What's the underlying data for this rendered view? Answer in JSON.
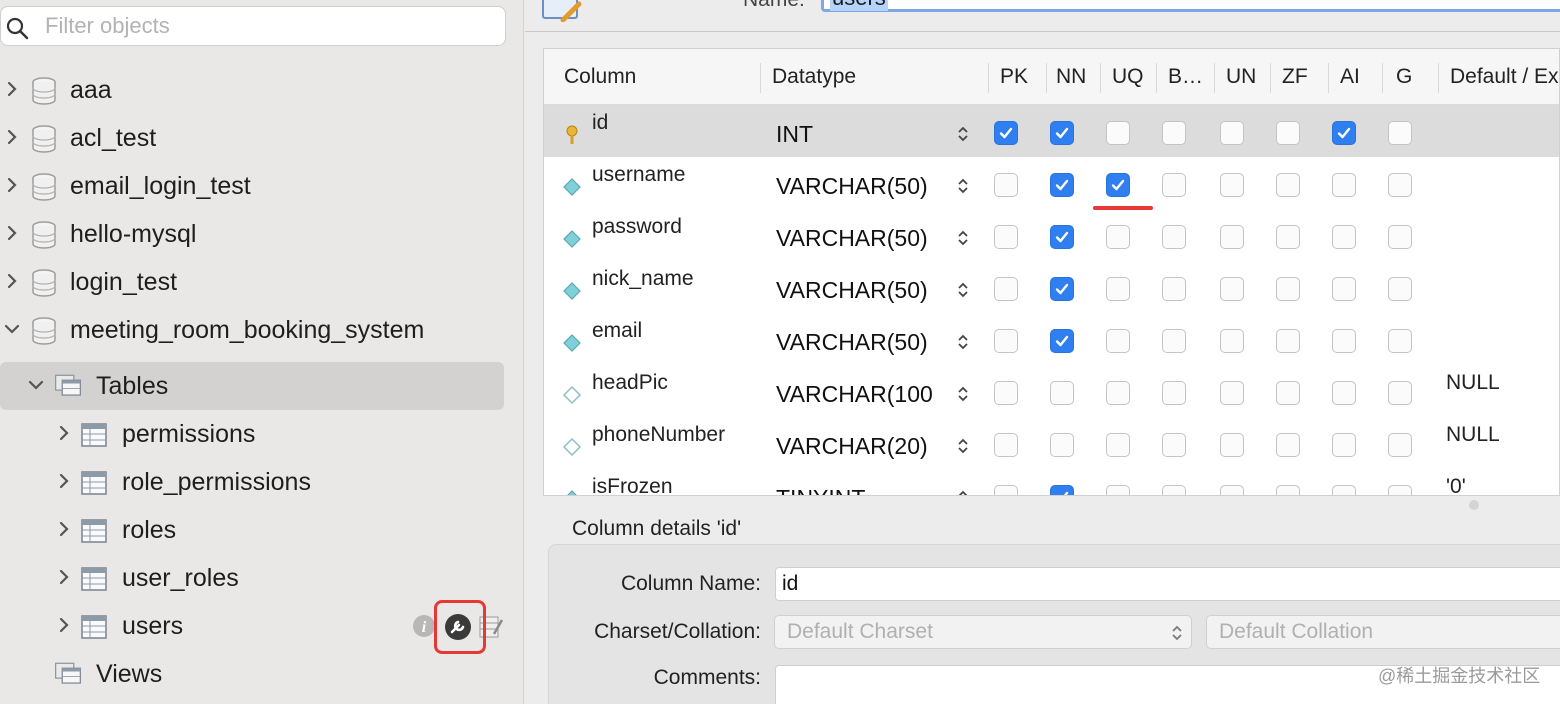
{
  "sidebar": {
    "filter_placeholder": "Filter objects",
    "schemas": [
      {
        "name": "aaa"
      },
      {
        "name": "acl_test"
      },
      {
        "name": "email_login_test"
      },
      {
        "name": "hello-mysql"
      },
      {
        "name": "login_test"
      },
      {
        "name": "meeting_room_booking_system"
      }
    ],
    "tables_label": "Tables",
    "tables": [
      {
        "name": "permissions"
      },
      {
        "name": "role_permissions"
      },
      {
        "name": "roles"
      },
      {
        "name": "user_roles"
      },
      {
        "name": "users"
      }
    ],
    "views_label": "Views"
  },
  "editor": {
    "name_label": "Name:",
    "name_value": "users",
    "columns_headers": [
      "Column",
      "Datatype",
      "PK",
      "NN",
      "UQ",
      "B…",
      "UN",
      "ZF",
      "AI",
      "G",
      "Default / Ex"
    ],
    "rows": [
      {
        "name": "id",
        "type": "INT",
        "flags": [
          true,
          true,
          false,
          false,
          false,
          false,
          true,
          false
        ],
        "default": "",
        "key": "primary"
      },
      {
        "name": "username",
        "type": "VARCHAR(50)",
        "flags": [
          false,
          true,
          true,
          false,
          false,
          false,
          false,
          false
        ],
        "default": "",
        "key": "column"
      },
      {
        "name": "password",
        "type": "VARCHAR(50)",
        "flags": [
          false,
          true,
          false,
          false,
          false,
          false,
          false,
          false
        ],
        "default": "",
        "key": "column"
      },
      {
        "name": "nick_name",
        "type": "VARCHAR(50)",
        "flags": [
          false,
          true,
          false,
          false,
          false,
          false,
          false,
          false
        ],
        "default": "",
        "key": "column"
      },
      {
        "name": "email",
        "type": "VARCHAR(50)",
        "flags": [
          false,
          true,
          false,
          false,
          false,
          false,
          false,
          false
        ],
        "default": "",
        "key": "column"
      },
      {
        "name": "headPic",
        "type": "VARCHAR(100",
        "flags": [
          false,
          false,
          false,
          false,
          false,
          false,
          false,
          false
        ],
        "default": "NULL",
        "key": "nullable"
      },
      {
        "name": "phoneNumber",
        "type": "VARCHAR(20)",
        "flags": [
          false,
          false,
          false,
          false,
          false,
          false,
          false,
          false
        ],
        "default": "NULL",
        "key": "nullable"
      },
      {
        "name": "isFrozen",
        "type": "TINYINT",
        "flags": [
          false,
          true,
          false,
          false,
          false,
          false,
          false,
          false
        ],
        "default": "'0'",
        "key": "column"
      }
    ],
    "details_title": "Column details 'id'",
    "column_name_label": "Column Name:",
    "column_name_value": "id",
    "charset_label": "Charset/Collation:",
    "charset_value": "Default Charset",
    "collation_value": "Default Collation",
    "comments_label": "Comments:"
  },
  "watermark": "@稀土掘金技术社区",
  "colors": {
    "accent": "#2f7ff0",
    "highlight": "#e53935",
    "selection": "#d4d2d0"
  }
}
